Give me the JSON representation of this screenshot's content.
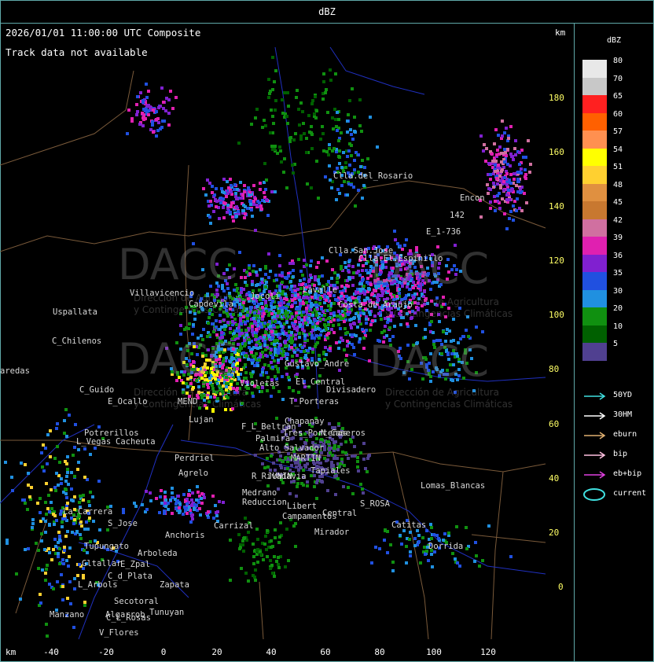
{
  "title": "dBZ",
  "map": {
    "header": "2026/01/01 11:00:00 UTC Composite",
    "status": "Track data not available",
    "unit_top": "km",
    "unit_bottom": "km",
    "y_axis": [
      "180",
      "160",
      "140",
      "120",
      "100",
      "80",
      "60",
      "40",
      "20",
      "0"
    ],
    "x_axis": [
      "-40",
      "-20",
      "0",
      "20",
      "40",
      "60",
      "80",
      "100",
      "120"
    ],
    "places": [
      "Clla.del_Rosario",
      "Encon",
      "142",
      "E_1-736",
      "Clla.San.Jose",
      "Clla.El.Espinillo",
      "Villavicencio",
      "Capdevila",
      "Uspallata",
      "C_Chilenos",
      "aredas",
      "C_Guido",
      "E_Ocallo",
      "MEND",
      "Potrerillos",
      "L_Vegas",
      "Cacheuta",
      "Lujan",
      "Perdriel",
      "Agrelo",
      "Tupungato",
      "E_Zpal",
      "Arboleda",
      "Gltallar",
      "C_d_Plata",
      "Zapata",
      "Tunuyan",
      "L_Arbols",
      "Algarrob",
      "Manzano",
      "Secotoral",
      "C_L_Rosas",
      "V_Flores",
      "La_Carrera",
      "S_Jose",
      "Anchoris",
      "Carrizal",
      "Medrano",
      "Reduccion",
      "R_Rivadavia",
      "Libert",
      "Campamentos",
      "Central",
      "Mirador",
      "S_ROSA",
      "Catitas",
      "Dorrida",
      "Lomas_Blancas",
      "Divisadero",
      "T_Porteras",
      "Violetas",
      "Chapanay",
      "N_Caseros",
      "Palmira",
      "MARTIN",
      "JUNIN",
      "Tres_Porteñas",
      "Tapiales",
      "Alto_Salvador",
      "Lavalle",
      "Jocoli",
      "Costa_de_Araujo",
      "El_Central",
      "Gustavo_Andre",
      "F_L_Beltran"
    ],
    "watermark": {
      "logo": "DACC",
      "line1": "Dirección de Agricultura",
      "line2": "y Contingencias Climáticas"
    }
  },
  "legend": {
    "title": "dBZ",
    "scale": [
      {
        "label": "80",
        "color": "#e8e8e8"
      },
      {
        "label": "70",
        "color": "#c8c8c8"
      },
      {
        "label": "65",
        "color": "#ff2020"
      },
      {
        "label": "60",
        "color": "#ff6000"
      },
      {
        "label": "57",
        "color": "#ff9050"
      },
      {
        "label": "54",
        "color": "#ffff00"
      },
      {
        "label": "51",
        "color": "#ffd030"
      },
      {
        "label": "48",
        "color": "#e09040"
      },
      {
        "label": "45",
        "color": "#c87830"
      },
      {
        "label": "42",
        "color": "#d070a0"
      },
      {
        "label": "39",
        "color": "#e020b0"
      },
      {
        "label": "36",
        "color": "#8020d0"
      },
      {
        "label": "35",
        "color": "#2050e0"
      },
      {
        "label": "30",
        "color": "#2090e0"
      },
      {
        "label": "20",
        "color": "#109010"
      },
      {
        "label": "10",
        "color": "#006000"
      },
      {
        "label": "5",
        "color": "#504090"
      }
    ],
    "tracks": [
      {
        "label": "50YD",
        "color": "#40e0e0"
      },
      {
        "label": "30HM",
        "color": "#ffffff"
      },
      {
        "label": "eburn",
        "color": "#e0b070"
      },
      {
        "label": "bip",
        "color": "#ffc0e0"
      },
      {
        "label": "eb+bip",
        "color": "#e040e0"
      },
      {
        "label": "current",
        "color": "#40e0e0"
      }
    ]
  }
}
